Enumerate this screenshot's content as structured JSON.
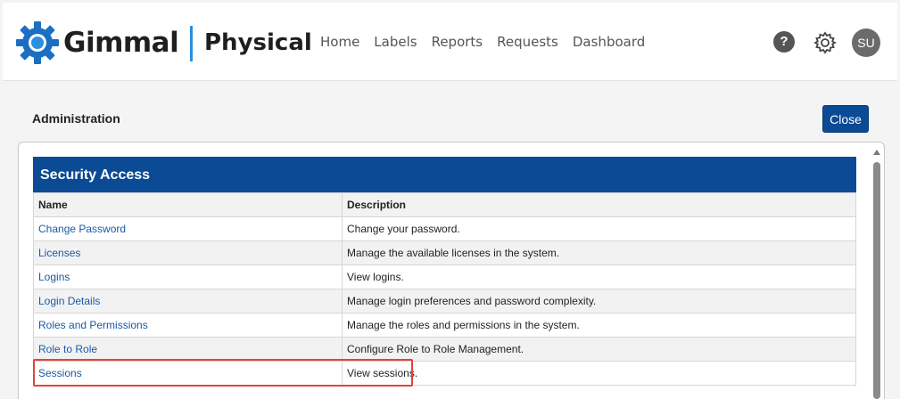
{
  "header": {
    "brand": "Gimmal",
    "product": "Physical",
    "nav": [
      "Home",
      "Labels",
      "Reports",
      "Requests",
      "Dashboard"
    ],
    "help_glyph": "?",
    "avatar_initials": "SU",
    "icons": {
      "logo": "gear-logo-icon",
      "help": "help-icon",
      "settings": "gear-icon"
    }
  },
  "page": {
    "title": "Administration",
    "close_label": "Close"
  },
  "section": {
    "title": "Security Access",
    "columns": [
      "Name",
      "Description"
    ],
    "rows": [
      {
        "name": "Change Password",
        "description": "Change your password."
      },
      {
        "name": "Licenses",
        "description": "Manage the available licenses in the system."
      },
      {
        "name": "Logins",
        "description": "View logins."
      },
      {
        "name": "Login Details",
        "description": "Manage login preferences and password complexity."
      },
      {
        "name": "Roles and Permissions",
        "description": "Manage the roles and permissions in the system."
      },
      {
        "name": "Role to Role",
        "description": "Configure Role to Role Management."
      },
      {
        "name": "Sessions",
        "description": "View sessions."
      }
    ]
  },
  "colors": {
    "brand_blue": "#0b4a94",
    "accent": "#2b8fe0",
    "highlight": "#e0443e",
    "link": "#1a5aa6"
  }
}
